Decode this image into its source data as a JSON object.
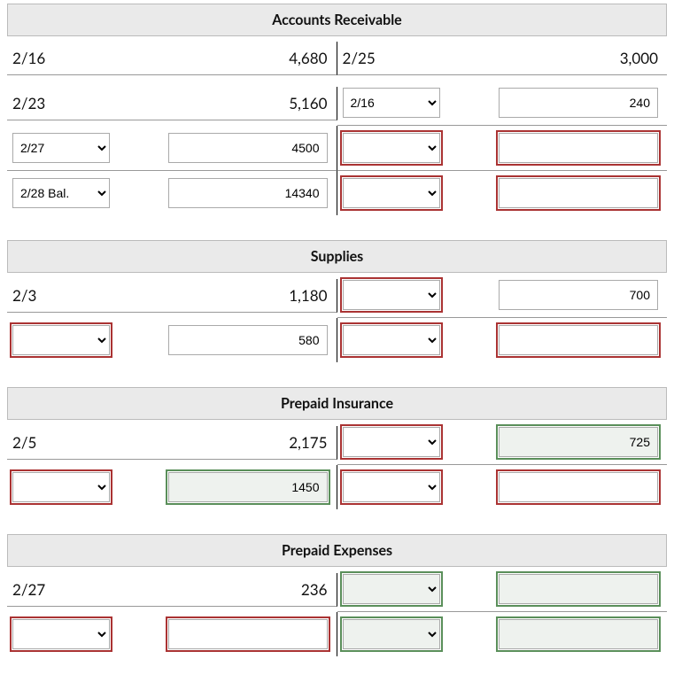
{
  "accounts": [
    {
      "title": "Accounts Receivable",
      "rows": [
        {
          "left": {
            "kind": "static",
            "date": "2/16",
            "amount": "4,680"
          },
          "right": {
            "kind": "static",
            "date": "2/25",
            "amount": "3,000"
          }
        },
        {
          "left": {
            "kind": "static",
            "date": "2/23",
            "amount": "5,160"
          },
          "right": {
            "kind": "input",
            "date": "2/16",
            "amount": "240",
            "dateState": "",
            "amtState": ""
          }
        },
        {
          "left": {
            "kind": "input",
            "date": "2/27",
            "amount": "4500",
            "dateState": "",
            "amtState": ""
          },
          "right": {
            "kind": "input",
            "date": "",
            "amount": "",
            "dateState": "err",
            "amtState": "err"
          }
        },
        {
          "left": {
            "kind": "input",
            "date": "2/28 Bal.",
            "amount": "14340",
            "dateState": "",
            "amtState": ""
          },
          "right": {
            "kind": "input",
            "date": "",
            "amount": "",
            "dateState": "err",
            "amtState": "err"
          },
          "noborder": true
        }
      ]
    },
    {
      "title": "Supplies",
      "rows": [
        {
          "left": {
            "kind": "static",
            "date": "2/3",
            "amount": "1,180"
          },
          "right": {
            "kind": "input",
            "date": "",
            "amount": "700",
            "dateState": "err",
            "amtState": ""
          }
        },
        {
          "left": {
            "kind": "input",
            "date": "",
            "amount": "580",
            "dateState": "err",
            "amtState": ""
          },
          "right": {
            "kind": "input",
            "date": "",
            "amount": "",
            "dateState": "err",
            "amtState": "err"
          },
          "noborder": true
        }
      ]
    },
    {
      "title": "Prepaid Insurance",
      "rows": [
        {
          "left": {
            "kind": "static",
            "date": "2/5",
            "amount": "2,175"
          },
          "right": {
            "kind": "input",
            "date": "",
            "amount": "725",
            "dateState": "err",
            "amtState": "ok-bg"
          }
        },
        {
          "left": {
            "kind": "input",
            "date": "",
            "amount": "1450",
            "dateState": "err",
            "amtState": "ok-bg"
          },
          "right": {
            "kind": "input",
            "date": "",
            "amount": "",
            "dateState": "err",
            "amtState": "err"
          },
          "noborder": true
        }
      ]
    },
    {
      "title": "Prepaid Expenses",
      "rows": [
        {
          "left": {
            "kind": "static",
            "date": "2/27",
            "amount": "236"
          },
          "right": {
            "kind": "input",
            "date": "",
            "amount": "",
            "dateState": "ok-bg",
            "amtState": "ok-bg"
          }
        },
        {
          "left": {
            "kind": "input",
            "date": "",
            "amount": "",
            "dateState": "err",
            "amtState": "err"
          },
          "right": {
            "kind": "input",
            "date": "",
            "amount": "",
            "dateState": "ok-bg",
            "amtState": "ok-bg"
          },
          "noborder": true
        }
      ]
    }
  ]
}
